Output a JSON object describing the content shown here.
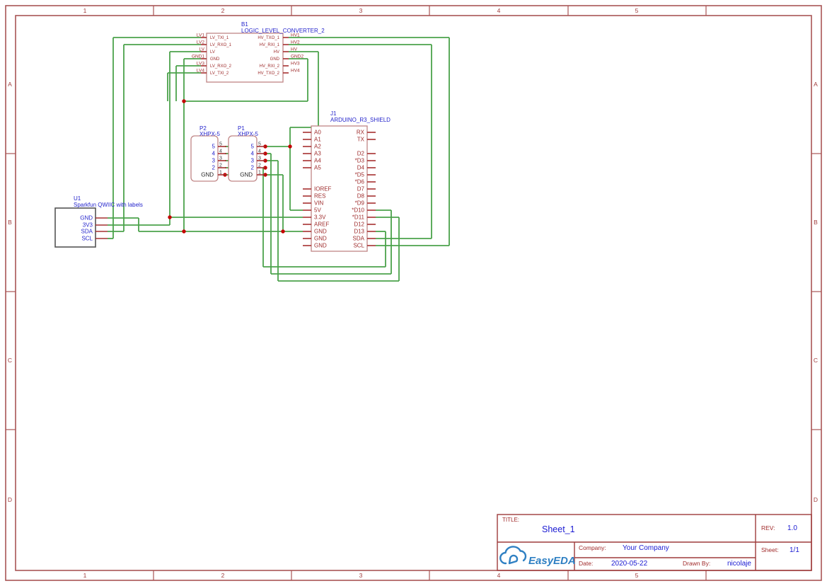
{
  "sheet": {
    "columns": [
      "1",
      "2",
      "3",
      "4",
      "5"
    ],
    "rows": [
      "A",
      "B",
      "C",
      "D"
    ]
  },
  "components": {
    "b1": {
      "refdes": "B1",
      "name": "LOGIC_LEVEL_CONVERTER_2",
      "left_pins": [
        {
          "net": "LV1",
          "name": "LV_TXI_1"
        },
        {
          "net": "LV2",
          "name": "LV_RXO_1"
        },
        {
          "net": "LV",
          "name": "LV"
        },
        {
          "net": "GND1",
          "name": "GND"
        },
        {
          "net": "LV3",
          "name": "LV_RXO_2"
        },
        {
          "net": "LV4",
          "name": "LV_TXI_2"
        }
      ],
      "right_pins": [
        {
          "net": "HV1",
          "name": "HV_TXO_1"
        },
        {
          "net": "HV2",
          "name": "HV_RXI_1"
        },
        {
          "net": "HV",
          "name": "HV"
        },
        {
          "net": "GND2",
          "name": "GND"
        },
        {
          "net": "HV3",
          "name": "HV_RXI_2"
        },
        {
          "net": "HV4",
          "name": "HV_TXO_2"
        }
      ]
    },
    "j1": {
      "refdes": "J1",
      "name": "ARDUINO_R3_SHIELD",
      "left_pins": [
        {
          "name": "A0",
          "row": 0
        },
        {
          "name": "A1",
          "row": 1
        },
        {
          "name": "A2",
          "row": 2
        },
        {
          "name": "A3",
          "row": 3
        },
        {
          "name": "A4",
          "row": 4
        },
        {
          "name": "A5",
          "row": 5
        },
        {
          "name": "IOREF",
          "row": 8
        },
        {
          "name": "RES",
          "row": 9
        },
        {
          "name": "VIN",
          "row": 10
        },
        {
          "name": "5V",
          "row": 11
        },
        {
          "name": "3.3V",
          "row": 12
        },
        {
          "name": "AREF",
          "row": 13
        },
        {
          "name": "GND",
          "row": 14
        },
        {
          "name": "GND",
          "row": 15
        },
        {
          "name": "GND",
          "row": 16
        }
      ],
      "right_pins": [
        {
          "name": "RX",
          "row": 0
        },
        {
          "name": "TX",
          "row": 1
        },
        {
          "name": "D2",
          "row": 3
        },
        {
          "name": "*D3",
          "row": 4
        },
        {
          "name": "D4",
          "row": 5
        },
        {
          "name": "*D5",
          "row": 6
        },
        {
          "name": "*D6",
          "row": 7
        },
        {
          "name": "D7",
          "row": 8
        },
        {
          "name": "D8",
          "row": 9
        },
        {
          "name": "*D9",
          "row": 10
        },
        {
          "name": "*D10",
          "row": 11
        },
        {
          "name": "*D11",
          "row": 12
        },
        {
          "name": "D12",
          "row": 13
        },
        {
          "name": "D13",
          "row": 14
        },
        {
          "name": "SDA",
          "row": 15
        },
        {
          "name": "SCL",
          "row": 16
        }
      ]
    },
    "p1": {
      "refdes": "P1",
      "name": "XHPX-5",
      "net_labels": [
        "5",
        "4",
        "3",
        "2"
      ],
      "gnd_label": "GND",
      "pin_numbers": [
        "5",
        "4",
        "3",
        "2",
        "1"
      ]
    },
    "p2": {
      "refdes": "P2",
      "name": "XHPX-5",
      "net_labels": [
        "5",
        "4",
        "3",
        "2"
      ],
      "gnd_label": "GND",
      "pin_numbers": [
        "5",
        "4",
        "3",
        "2",
        "1"
      ]
    },
    "u1": {
      "refdes": "U1",
      "name": "Sparkfun QWIIC with labels",
      "pins": [
        "GND",
        "3V3",
        "SDA",
        "SCL"
      ]
    }
  },
  "title_block": {
    "title_label": "TITLE:",
    "title": "Sheet_1",
    "rev_label": "REV:",
    "rev": "1.0",
    "company_label": "Company:",
    "company": "Your Company",
    "sheet_label": "Sheet:",
    "sheet": "1/1",
    "date_label": "Date:",
    "date": "2020-05-22",
    "drawn_by_label": "Drawn By:",
    "drawn_by": "nicolaje",
    "logo_text": "EasyEDA"
  },
  "colors": {
    "wire": "#4ba24b",
    "junction": "#c40000",
    "component_outline": "#c08686",
    "pin_text": "#9e2b2b",
    "blue_text": "#2424cc",
    "frame": "#a85555",
    "logo_blue": "#2f80c3",
    "value_blue": "#1a1ad2"
  }
}
